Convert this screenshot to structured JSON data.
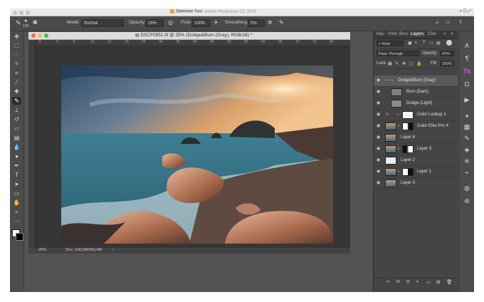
{
  "app": {
    "title": "Selective Tool",
    "title_ghost": "Adobe Photoshop CC 2018"
  },
  "options_bar": {
    "brush_size": "125",
    "mode_label": "Mode:",
    "mode_value": "Normal",
    "opacity_label": "Opacity:",
    "opacity_value": "16%",
    "flow_label": "Flow:",
    "flow_value": "100%",
    "smoothing_label": "Smoothing:",
    "smoothing_value": "0%"
  },
  "document": {
    "title": "DSCF0951.tif @ 25% (Dodge&Burn (Gray), RGB/16) *",
    "ruler_numbers": [
      "5",
      "0",
      "5",
      "10",
      "15",
      "20",
      "25",
      "30",
      "35",
      "40",
      "45",
      "50",
      "55",
      "60",
      "65",
      "70",
      "75",
      "80"
    ],
    "zoom": "25%",
    "doc_info": "Doc: 138,0M/960,4M"
  },
  "layers_panel": {
    "tabs": [
      "Adju",
      "Histo",
      "Brus",
      "Layers",
      "Clon"
    ],
    "active_tab": "Layers",
    "filter_kind": "Kind",
    "blend_mode": "Pass Through",
    "opacity_label": "Opacity:",
    "opacity_value": "47%",
    "lock_label": "Lock:",
    "fill_label": "Fill:",
    "fill_value": "100%",
    "layers": [
      {
        "name": "Dodge&Burn (Gray)",
        "type": "group"
      },
      {
        "name": "Burn (Dark)",
        "type": "child"
      },
      {
        "name": "Dodge (Light)",
        "type": "child"
      },
      {
        "name": "Color Lookup 1",
        "type": "adjustment"
      },
      {
        "name": "Color Efex Pro 4",
        "type": "masked"
      },
      {
        "name": "Layer 4",
        "type": "image"
      },
      {
        "name": "Layer 3",
        "type": "masked"
      },
      {
        "name": "Layer 2",
        "type": "empty"
      },
      {
        "name": "Layer 1",
        "type": "masked"
      },
      {
        "name": "Layer 0",
        "type": "image"
      }
    ]
  },
  "colors": {
    "app_bg": "#535353",
    "panel_bg": "#454545",
    "selection": "#5a5a5a"
  }
}
